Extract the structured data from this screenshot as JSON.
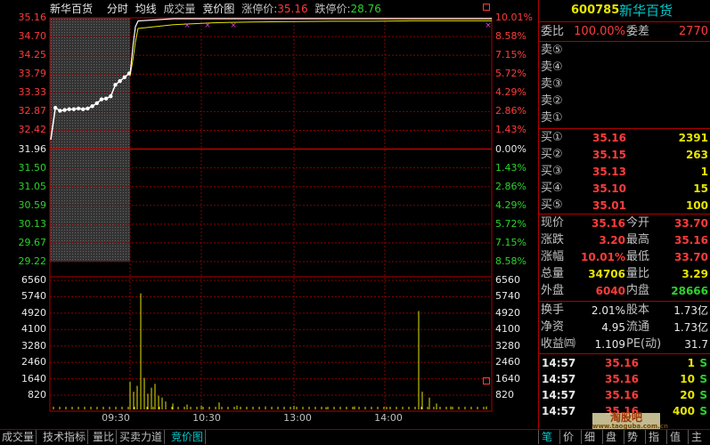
{
  "chart_header": {
    "stock_name": "新华百货",
    "tab_intraday": "分时",
    "tab_avg": "均线",
    "tab_volume": "成交量",
    "tab_auction": "竞价图",
    "limit_up_label": "涨停价:",
    "limit_up_value": "35.16",
    "limit_down_label": "跌停价:",
    "limit_down_value": "28.76"
  },
  "colors": {
    "up": "#ff3b3b",
    "down": "#2cd22c",
    "price_line": "#ffffff",
    "avg_line": "#e5e500",
    "volume_bar": "#e5e500",
    "grid": "#8a0000",
    "auction_bg": "#3a3a3a",
    "accent": "#00c8c8"
  },
  "chart_data": [
    {
      "type": "line",
      "name": "intraday-price",
      "x_ticks": [
        "09:30",
        "10:30",
        "13:00",
        "14:00"
      ],
      "y_ticks_price": [
        "35.16",
        "34.70",
        "34.25",
        "33.79",
        "33.33",
        "32.87",
        "32.42",
        "31.96",
        "31.50",
        "31.05",
        "30.59",
        "30.13",
        "29.67",
        "29.22"
      ],
      "y_ticks_pct": [
        "10.01%",
        "8.58%",
        "7.15%",
        "5.72%",
        "4.29%",
        "2.86%",
        "1.43%",
        "0.00%",
        "1.43%",
        "2.86%",
        "4.29%",
        "5.72%",
        "7.15%",
        "8.58%"
      ],
      "ylim": [
        28.76,
        35.16
      ],
      "prev_close": 31.96,
      "auction_points": [
        31.96,
        32.8,
        32.72,
        32.74,
        32.76,
        32.76,
        32.78,
        32.76,
        32.78,
        32.84,
        32.92,
        33.02,
        33.04,
        33.1,
        33.4,
        33.5,
        33.6,
        33.7
      ],
      "trading_series": [
        {
          "name": "price",
          "values": [
            33.7,
            34.4,
            34.95,
            35.1,
            35.16,
            35.16,
            35.16,
            35.16,
            35.16,
            35.16,
            35.16,
            35.16,
            35.16
          ]
        },
        {
          "name": "average",
          "values": [
            33.7,
            34.1,
            34.6,
            34.95,
            35.05,
            35.1,
            35.12,
            35.13,
            35.14,
            35.14,
            35.15,
            35.15,
            35.15
          ]
        }
      ]
    },
    {
      "type": "bar",
      "name": "volume",
      "y_ticks": [
        "6560",
        "5740",
        "4920",
        "4100",
        "3280",
        "2460",
        "1640",
        "820"
      ],
      "ylim": [
        0,
        6560
      ],
      "bars": [
        {
          "t": 0,
          "v": 1400
        },
        {
          "t": 1,
          "v": 900
        },
        {
          "t": 2,
          "v": 1200
        },
        {
          "t": 3,
          "v": 5900
        },
        {
          "t": 4,
          "v": 1600
        },
        {
          "t": 5,
          "v": 800
        },
        {
          "t": 6,
          "v": 1100
        },
        {
          "t": 7,
          "v": 1300
        },
        {
          "t": 8,
          "v": 700
        },
        {
          "t": 9,
          "v": 600
        },
        {
          "t": 10,
          "v": 400
        },
        {
          "t": 12,
          "v": 300
        },
        {
          "t": 16,
          "v": 250
        },
        {
          "t": 20,
          "v": 200
        },
        {
          "t": 25,
          "v": 350
        },
        {
          "t": 30,
          "v": 200
        },
        {
          "t": 38,
          "v": 150
        },
        {
          "t": 46,
          "v": 180
        },
        {
          "t": 55,
          "v": 120
        },
        {
          "t": 63,
          "v": 150
        },
        {
          "t": 72,
          "v": 130
        },
        {
          "t": 81,
          "v": 5000
        },
        {
          "t": 82,
          "v": 900
        },
        {
          "t": 84,
          "v": 600
        },
        {
          "t": 86,
          "v": 300
        },
        {
          "t": 90,
          "v": 150
        },
        {
          "t": 100,
          "v": 150
        }
      ]
    }
  ],
  "panel": {
    "code": "600785",
    "name": "新华百货",
    "weibi_label": "委比",
    "weibi_value": "100.00%",
    "weicha_label": "委差",
    "weicha_value": "2770",
    "sells": [
      "卖⑤",
      "卖④",
      "卖③",
      "卖②",
      "卖①"
    ],
    "buys": [
      {
        "label": "买①",
        "price": "35.16",
        "vol": "2391"
      },
      {
        "label": "买②",
        "price": "35.15",
        "vol": "263"
      },
      {
        "label": "买③",
        "price": "35.13",
        "vol": "1"
      },
      {
        "label": "买④",
        "price": "35.10",
        "vol": "15"
      },
      {
        "label": "买⑤",
        "price": "35.01",
        "vol": "100"
      }
    ],
    "quote": [
      {
        "l1": "现价",
        "v1": "35.16",
        "l2": "今开",
        "v2": "33.70"
      },
      {
        "l1": "涨跌",
        "v1": "3.20",
        "l2": "最高",
        "v2": "35.16"
      },
      {
        "l1": "涨幅",
        "v1": "10.01%",
        "l2": "最低",
        "v2": "33.70"
      },
      {
        "l1": "总量",
        "v1": "34706",
        "l2": "量比",
        "v2": "3.29"
      },
      {
        "l1": "外盘",
        "v1": "6040",
        "l2": "内盘",
        "v2": "28666"
      }
    ],
    "fund": [
      {
        "l1": "换手",
        "v1": "2.01%",
        "l2": "股本",
        "v2": "1.73亿"
      },
      {
        "l1": "净资",
        "v1": "4.95",
        "l2": "流通",
        "v2": "1.73亿"
      },
      {
        "l1": "收益㈣",
        "v1": "1.109",
        "l2": "PE(动)",
        "v2": "31.7"
      }
    ],
    "ticks": [
      {
        "time": "14:57",
        "price": "35.16",
        "vol": "1",
        "side": "S"
      },
      {
        "time": "14:57",
        "price": "35.16",
        "vol": "10",
        "side": "S"
      },
      {
        "time": "14:57",
        "price": "35.16",
        "vol": "20",
        "side": "S"
      },
      {
        "time": "14:57",
        "price": "35.16",
        "vol": "400",
        "side": "S"
      }
    ],
    "watermark_top": "淘股吧",
    "watermark_bottom": "www.taoguba.com.cn"
  },
  "bottom_tabs": [
    "成交量",
    "技术指标",
    "量比",
    "买卖力道",
    "竞价图"
  ],
  "right_tabs": [
    "笔",
    "价",
    "细",
    "盘",
    "势",
    "指",
    "值",
    "主"
  ]
}
